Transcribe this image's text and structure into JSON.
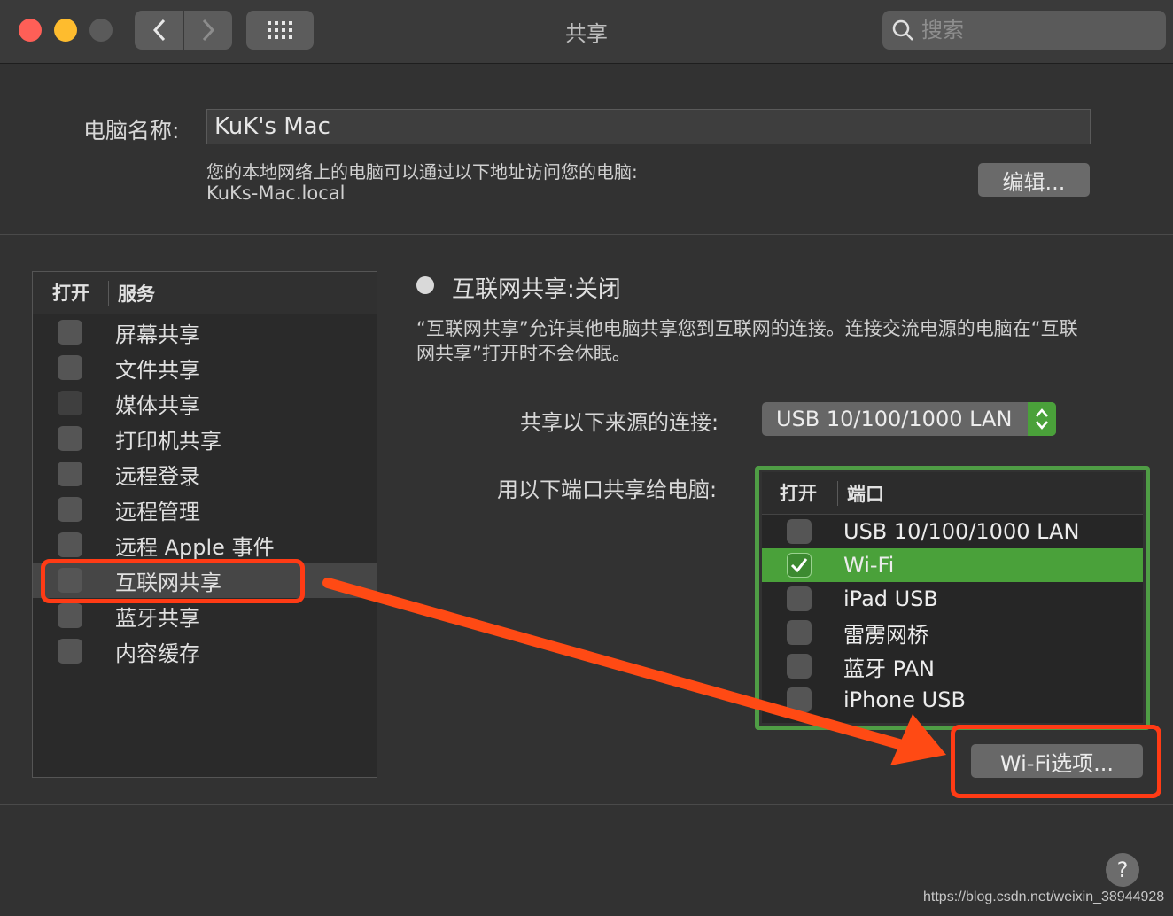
{
  "window": {
    "title": "共享"
  },
  "traffic_lights": {
    "close": "#fe5f57",
    "minimize": "#febc2e",
    "zoom": "#5a5a5a"
  },
  "search": {
    "placeholder": "搜索"
  },
  "computer_name": {
    "label": "电脑名称:",
    "value": "KuK's Mac",
    "description": "您的本地网络上的电脑可以通过以下地址访问您的电脑:",
    "address": "KuKs-Mac.local",
    "edit_button": "编辑..."
  },
  "services": {
    "header_open": "打开",
    "header_service": "服务",
    "items": [
      {
        "label": "屏幕共享",
        "checked": false
      },
      {
        "label": "文件共享",
        "checked": false
      },
      {
        "label": "媒体共享",
        "checked": false
      },
      {
        "label": "打印机共享",
        "checked": false
      },
      {
        "label": "远程登录",
        "checked": false
      },
      {
        "label": "远程管理",
        "checked": false
      },
      {
        "label": "远程 Apple 事件",
        "checked": false
      },
      {
        "label": "互联网共享",
        "checked": false,
        "selected": true
      },
      {
        "label": "蓝牙共享",
        "checked": false
      },
      {
        "label": "内容缓存",
        "checked": false
      }
    ]
  },
  "internet_sharing": {
    "status": "互联网共享:关闭",
    "info_line1": "“互联网共享”允许其他电脑共享您到互联网的连接。连接交流电源的电脑在“互联",
    "info_line2": "网共享”打开时不会休眠。",
    "source_label": "共享以下来源的连接:",
    "source_value": "USB 10/100/1000 LAN",
    "ports_label": "用以下端口共享给电脑:",
    "ports_header_open": "打开",
    "ports_header_port": "端口",
    "ports": [
      {
        "label": "USB 10/100/1000 LAN",
        "checked": false
      },
      {
        "label": "Wi-Fi",
        "checked": true,
        "selected": true
      },
      {
        "label": "iPad USB",
        "checked": false
      },
      {
        "label": "雷雳网桥",
        "checked": false
      },
      {
        "label": "蓝牙 PAN",
        "checked": false
      },
      {
        "label": "iPhone USB",
        "checked": false
      }
    ],
    "wifi_options_button": "Wi-Fi选项..."
  },
  "help": {
    "label": "?"
  },
  "watermark": "https://blog.csdn.net/weixin_38944928",
  "accent_colors": {
    "annotation_red": "#ff3b15",
    "annotation_green": "#4f9d45",
    "selection_green": "#4aa13a"
  }
}
